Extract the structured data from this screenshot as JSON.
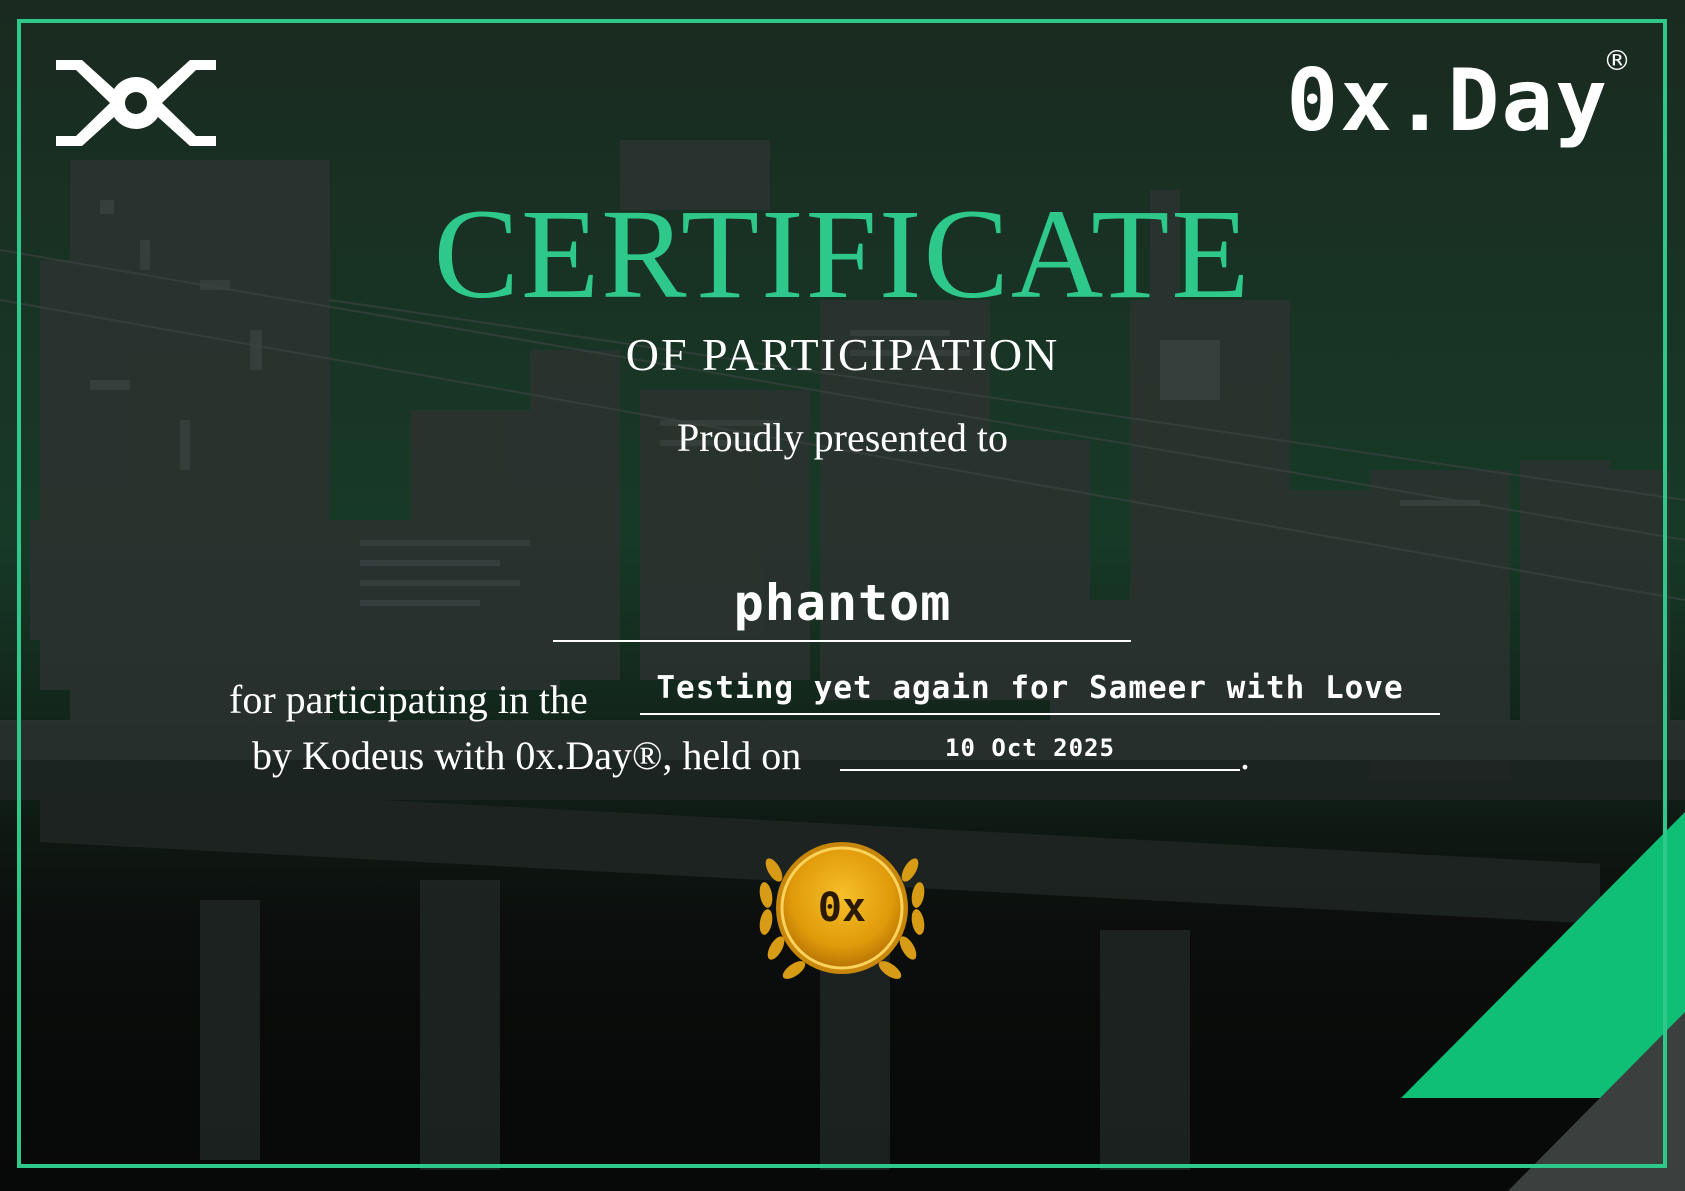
{
  "brand": {
    "name": "0x.Day",
    "registered_mark": "®"
  },
  "certificate": {
    "title": "CERTIFICATE",
    "subtitle": "OF PARTICIPATION",
    "presented_label": "Proudly presented to",
    "recipient": "phantom",
    "participation_prefix": "for participating in the",
    "event_name": "Testing yet again for Sameer with Love",
    "organizer_text": "by Kodeus with 0x.Day®, held on",
    "date": "10 Oct 2025",
    "date_suffix": "."
  },
  "seal": {
    "label": "0x"
  },
  "colors": {
    "accent": "#2ec98a",
    "corner_green": "#0fbf76",
    "text": "#ffffff",
    "seal_gold": "#e6a20c"
  },
  "icons": {
    "logo_left": "eye-logo-icon",
    "seal": "laurel-seal-icon"
  }
}
